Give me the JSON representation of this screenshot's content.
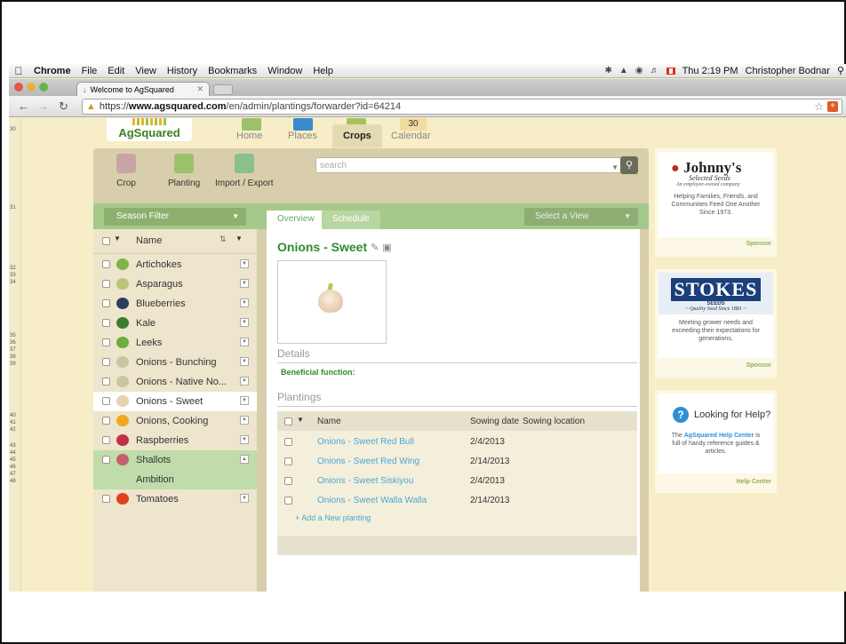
{
  "menubar": {
    "app": "Chrome",
    "items": [
      "File",
      "Edit",
      "View",
      "History",
      "Bookmarks",
      "Window",
      "Help"
    ],
    "clock": "Thu 2:19 PM",
    "user": "Christopher Bodnar"
  },
  "browser": {
    "tab_title": "Welcome to AgSquared",
    "url_scheme": "https://",
    "url_host": "www.agsquared.com",
    "url_path": "/en/admin/plantings/forwarder?id=64214"
  },
  "gutter": [
    "30",
    "31",
    "32",
    "33",
    "34",
    "35",
    "36",
    "37",
    "38",
    "39",
    "40",
    "41",
    "42",
    "43",
    "44",
    "45",
    "46",
    "47",
    "48"
  ],
  "site": {
    "logo": "AgSquared",
    "nav": [
      "Home",
      "Places",
      "Crops",
      "Calendar"
    ],
    "calendar_day": "30"
  },
  "actions": {
    "crop": "Crop",
    "planting": "Planting",
    "import_export": "Import / Export",
    "search_placeholder": "search"
  },
  "filters": {
    "season": "Season Filter",
    "tab_overview": "Overview",
    "tab_schedule": "Schedule",
    "select_view": "Select a View"
  },
  "list": {
    "header": "Name",
    "items": [
      {
        "label": "Artichokes",
        "color": "#7fb34a"
      },
      {
        "label": "Asparagus",
        "color": "#b9c47a"
      },
      {
        "label": "Blueberries",
        "color": "#2c3d5e"
      },
      {
        "label": "Kale",
        "color": "#3b7d2e"
      },
      {
        "label": "Leeks",
        "color": "#6cae3a"
      },
      {
        "label": "Onions - Bunching",
        "color": "#c8c8a0"
      },
      {
        "label": "Onions - Native No...",
        "color": "#c8c8a0"
      },
      {
        "label": "Onions - Sweet",
        "color": "#e8d0b0"
      },
      {
        "label": "Onions, Cooking",
        "color": "#f2a623"
      },
      {
        "label": "Raspberries",
        "color": "#c0304a"
      },
      {
        "label": "Shallots",
        "color": "#c65e6e"
      },
      {
        "label": "Ambition",
        "color": ""
      },
      {
        "label": "Tomatoes",
        "color": "#e0401e"
      }
    ]
  },
  "detail": {
    "title": "Onions - Sweet",
    "details_heading": "Details",
    "beneficial": "Beneficial function:",
    "plantings_heading": "Plantings",
    "columns": [
      "Name",
      "Sowing date",
      "Sowing location"
    ],
    "rows": [
      {
        "name": "Onions - Sweet Red Bull",
        "date": "2/4/2013"
      },
      {
        "name": "Onions - Sweet Red Wing",
        "date": "2/14/2013"
      },
      {
        "name": "Onions - Sweet Siskiyou",
        "date": "2/4/2013"
      },
      {
        "name": "Onions - Sweet Walla Walla",
        "date": "2/14/2013"
      }
    ],
    "add_link": "+ Add a New planting"
  },
  "sponsors": {
    "johnny": {
      "brand": "Johnny's",
      "sub": "Selected Seeds",
      "tag": "An employee-owned company",
      "text": "Helping Families, Friends, and Communities Feed One Another Since 1973.",
      "label": "Sponsor"
    },
    "stokes": {
      "brand": "STOKES",
      "sub": "SEEDS",
      "tag": "~ Quality Seed Since 1881 ~",
      "text": "Meeting grower needs and exceeding their expectations for generations.",
      "label": "Sponsor"
    },
    "help": {
      "title": "Looking for Help?",
      "text_pre": "The",
      "text_link": "AgSquared Help Center",
      "text_post": "is full of handy reference guides & articles.",
      "label": "Help Center"
    }
  }
}
